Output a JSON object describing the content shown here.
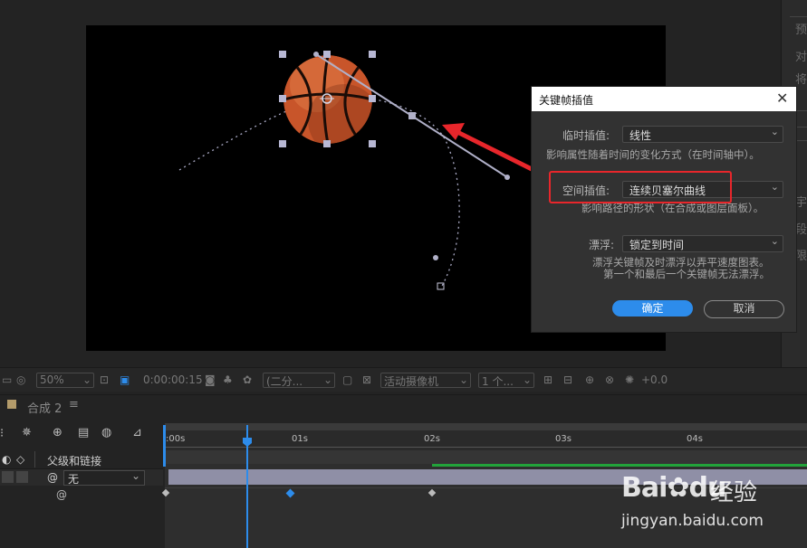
{
  "dialog": {
    "title": "关键帧插值",
    "close_glyph": "✕",
    "temporal_label": "临时插值:",
    "temporal_value": "线性",
    "temporal_desc": "影响属性随着时间的变化方式（在时间轴中）。",
    "spatial_label": "空间插值:",
    "spatial_value": "连续贝塞尔曲线",
    "spatial_desc": "影响路径的形状（在合成或图层面板）。",
    "roving_label": "漂浮:",
    "roving_value": "锁定到时间",
    "roving_desc_1": "漂浮关键帧及时漂浮以弄平速度图表。",
    "roving_desc_2": "第一个和最后一个关键帧无法漂浮。",
    "ok_label": "确定",
    "cancel_label": "取消",
    "dropdown_glyph": "⌄"
  },
  "viewer_toolbar": {
    "zoom": "50%",
    "timecode": "0:00:00:15",
    "resolution": "(二分...",
    "camera": "活动摄像机",
    "views": "1 个...",
    "exposure": "+0.0"
  },
  "timeline": {
    "comp_tab": "合成 2",
    "menu_glyph": "≡",
    "ruler_labels": [
      ":00s",
      "01s",
      "02s",
      "03s",
      "04s"
    ],
    "parent_header": "父级和链接",
    "parent_value": "无",
    "spiral_glyph": "@"
  },
  "right_panel_chars": [
    "预",
    "对",
    "将",
    "宇",
    "段",
    "限"
  ],
  "watermark": {
    "brand": "Bai",
    "brand_paw": "du",
    "cn": "经验",
    "url": "jingyan.baidu.com"
  },
  "colors": {
    "accent_blue": "#2d8ceb",
    "highlight_red": "#e8262b",
    "layer_bar": "#8f8fa6",
    "keyframe_blue": "#2d8ceb",
    "work_area_green": "#22a33a"
  }
}
